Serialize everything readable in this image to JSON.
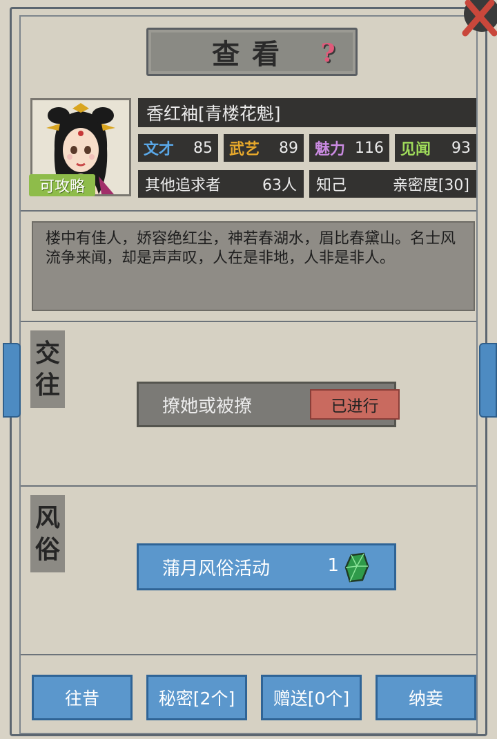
{
  "header": {
    "title": "查看",
    "help_glyph": "?"
  },
  "character": {
    "name": "香红袖[青楼花魁]",
    "tag": "可攻略",
    "stats": [
      {
        "label": "文才",
        "value": "85",
        "color": "#5aa8e8"
      },
      {
        "label": "武艺",
        "value": "89",
        "color": "#e8a92b"
      },
      {
        "label": "魅力",
        "value": "116",
        "color": "#c98ae0"
      },
      {
        "label": "见闻",
        "value": "93",
        "color": "#9fdc5a"
      }
    ],
    "suitors_label": "其他追求者",
    "suitors_value": "63人",
    "relation_label": "知己",
    "intimacy": "亲密度[30]"
  },
  "description": "楼中有佳人，娇容绝红尘，神若春湖水，眉比春黛山。名士风流争来闻，却是声声叹，人在是非地，人非是非人。",
  "sections": {
    "interaction": {
      "label_1": "交",
      "label_2": "往",
      "action": "撩她或被撩",
      "status": "已进行"
    },
    "customs": {
      "label_1": "风",
      "label_2": "俗",
      "action": "蒲月风俗活动",
      "cost": "1"
    }
  },
  "buttons": {
    "past": "往昔",
    "secret": "秘密[2个]",
    "gift": "赠送[0个]",
    "marry": "纳妾"
  },
  "icons": {
    "help": "question-icon",
    "close": "close-icon",
    "gem": "jade-gem-icon"
  }
}
